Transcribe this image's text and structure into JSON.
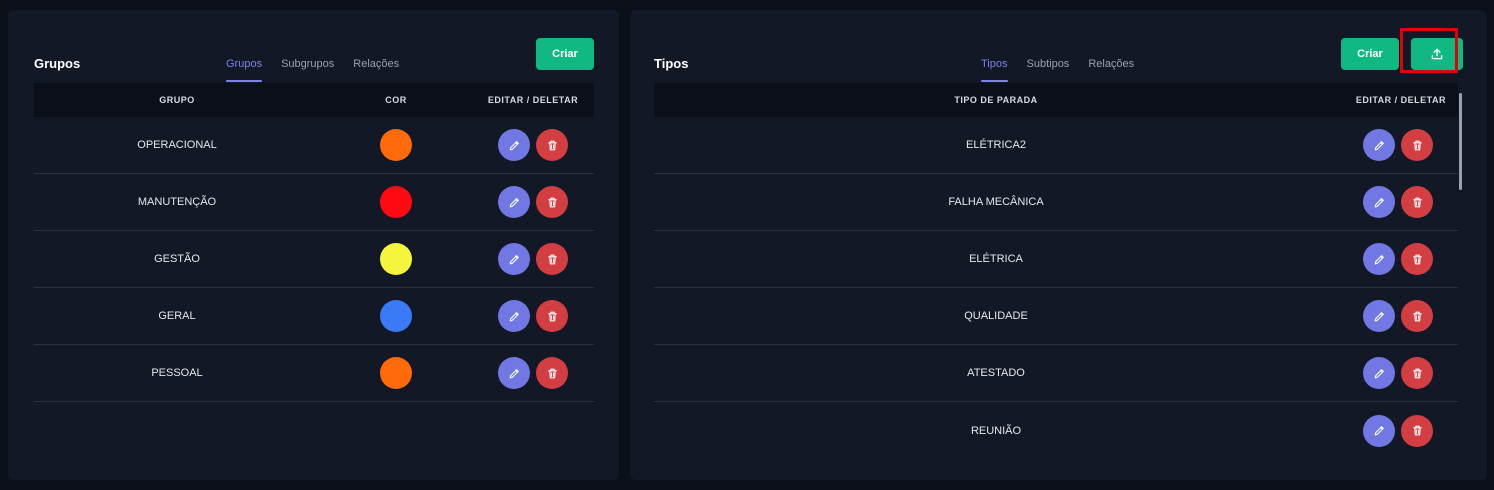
{
  "groups_panel": {
    "title": "Grupos",
    "tabs": [
      {
        "label": "Grupos",
        "active": true
      },
      {
        "label": "Subgrupos",
        "active": false
      },
      {
        "label": "Relações",
        "active": false
      }
    ],
    "create_label": "Criar",
    "columns": [
      "GRUPO",
      "COR",
      "EDITAR / DELETAR"
    ],
    "rows": [
      {
        "name": "OPERACIONAL",
        "color": "#ff6a0a"
      },
      {
        "name": "MANUTENÇÃO",
        "color": "#ff0a12"
      },
      {
        "name": "GESTÃO",
        "color": "#f5f53d"
      },
      {
        "name": "GERAL",
        "color": "#3b7af7"
      },
      {
        "name": "PESSOAL",
        "color": "#ff6a0a"
      }
    ]
  },
  "types_panel": {
    "title": "Tipos",
    "tabs": [
      {
        "label": "Tipos",
        "active": true
      },
      {
        "label": "Subtipos",
        "active": false
      },
      {
        "label": "Relações",
        "active": false
      }
    ],
    "create_label": "Criar",
    "upload_icon": "upload-icon",
    "columns": [
      "TIPO DE PARADA",
      "EDITAR / DELETAR"
    ],
    "rows": [
      {
        "name": "ELÉTRICA2"
      },
      {
        "name": "FALHA MECÂNICA"
      },
      {
        "name": "ELÉTRICA"
      },
      {
        "name": "QUALIDADE"
      },
      {
        "name": "ATESTADO"
      },
      {
        "name": "REUNIÃO"
      }
    ]
  },
  "colors": {
    "accent_green": "#10b981",
    "accent_purple": "#7c84e8",
    "edit_button": "#7178e3",
    "delete_button": "#d33e42",
    "highlight": "#e3000b"
  }
}
